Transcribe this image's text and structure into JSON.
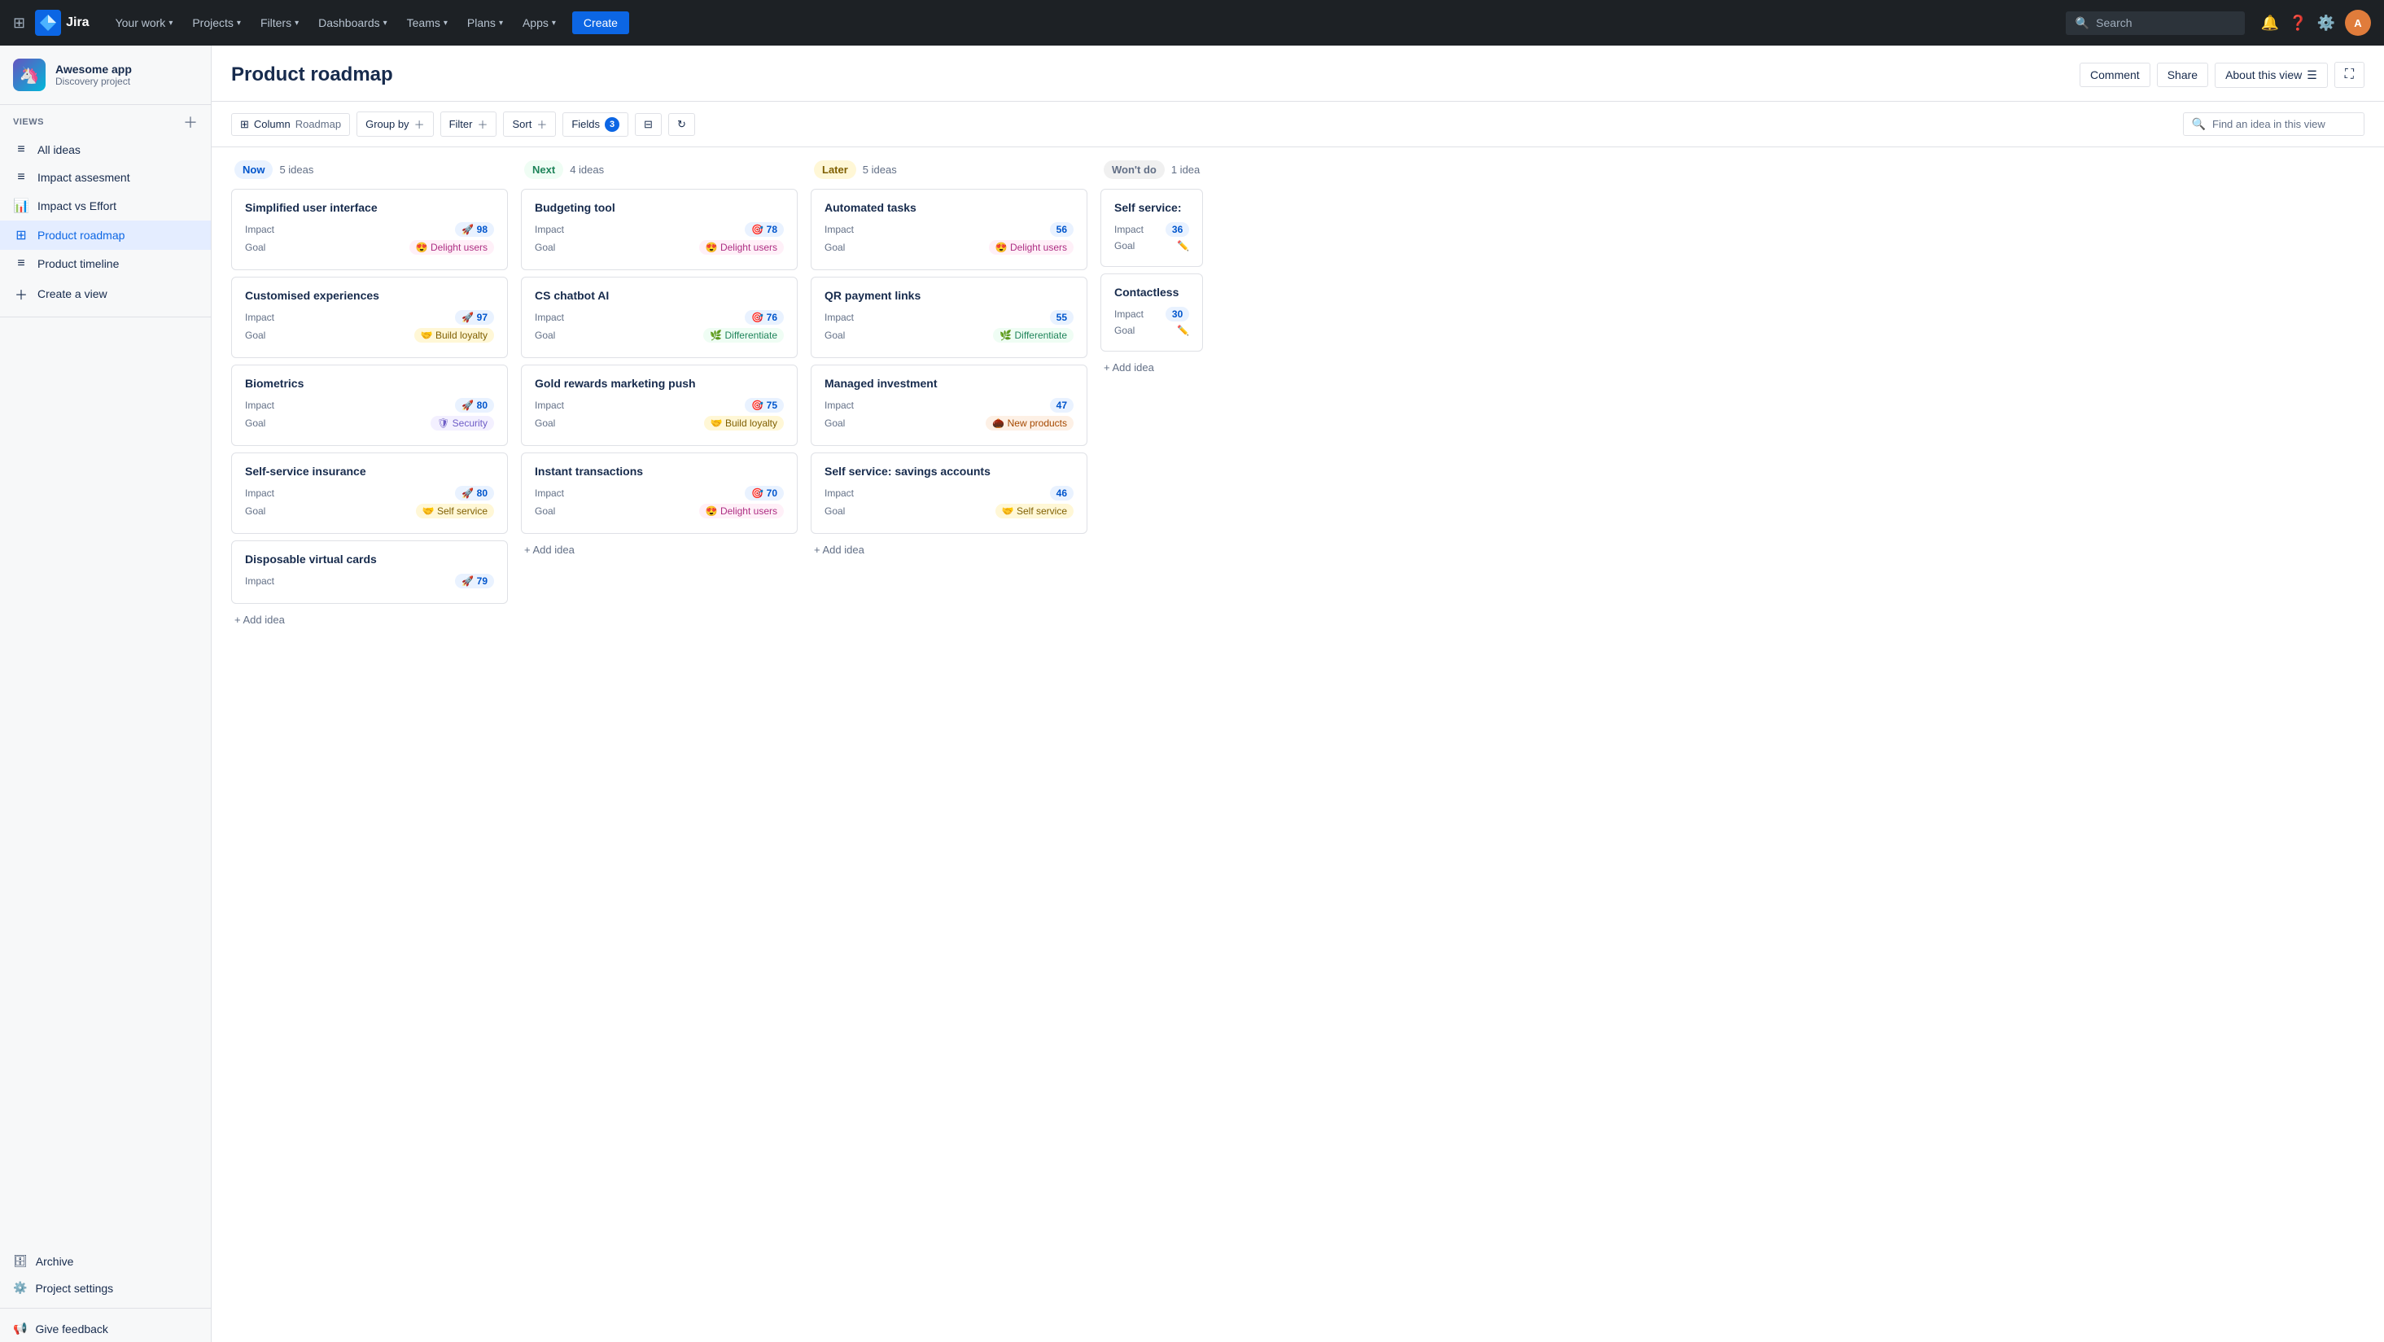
{
  "topnav": {
    "logo_text": "Jira",
    "items": [
      {
        "label": "Your work",
        "key": "your-work"
      },
      {
        "label": "Projects",
        "key": "projects"
      },
      {
        "label": "Filters",
        "key": "filters"
      },
      {
        "label": "Dashboards",
        "key": "dashboards"
      },
      {
        "label": "Teams",
        "key": "teams"
      },
      {
        "label": "Plans",
        "key": "plans"
      },
      {
        "label": "Apps",
        "key": "apps"
      }
    ],
    "create_label": "Create",
    "search_placeholder": "Search"
  },
  "sidebar": {
    "project_name": "Awesome app",
    "project_type": "Discovery project",
    "views_label": "VIEWS",
    "items": [
      {
        "label": "All ideas",
        "icon": "≡",
        "active": false
      },
      {
        "label": "Impact assesment",
        "icon": "≡",
        "active": false
      },
      {
        "label": "Impact vs Effort",
        "icon": "📊",
        "active": false
      },
      {
        "label": "Product roadmap",
        "icon": "⊞",
        "active": true
      },
      {
        "label": "Product timeline",
        "icon": "≡",
        "active": false
      }
    ],
    "create_view_label": "Create a view",
    "archive_label": "Archive",
    "settings_label": "Project settings",
    "feedback_label": "Give feedback"
  },
  "page": {
    "title": "Product roadmap",
    "comment_label": "Comment",
    "share_label": "Share",
    "about_label": "About this view"
  },
  "toolbar": {
    "column_label": "Column",
    "column_icon": "Roadmap",
    "groupby_label": "Group by",
    "filter_label": "Filter",
    "sort_label": "Sort",
    "fields_label": "Fields",
    "fields_count": "3",
    "search_placeholder": "Find an idea in this view"
  },
  "columns": [
    {
      "id": "now",
      "badge": "Now",
      "badge_class": "badge-now",
      "count": "5 ideas",
      "cards": [
        {
          "title": "Simplified user interface",
          "impact": "98",
          "impact_icon": "🚀",
          "goal": "Delight users",
          "goal_icon": "😍",
          "goal_class": "goal-delight"
        },
        {
          "title": "Customised experiences",
          "impact": "97",
          "impact_icon": "🚀",
          "goal": "Build loyalty",
          "goal_icon": "🤝",
          "goal_class": "goal-loyalty"
        },
        {
          "title": "Biometrics",
          "impact": "80",
          "impact_icon": "🚀",
          "goal": "Security",
          "goal_icon": "🛡",
          "goal_class": "goal-security"
        },
        {
          "title": "Self-service insurance",
          "impact": "80",
          "impact_icon": "🚀",
          "goal": "Self service",
          "goal_icon": "🤝",
          "goal_class": "goal-self"
        },
        {
          "title": "Disposable virtual cards",
          "impact": "79",
          "impact_icon": "🚀",
          "goal": "",
          "goal_icon": "",
          "goal_class": ""
        }
      ],
      "add_label": "+ Add idea"
    },
    {
      "id": "next",
      "badge": "Next",
      "badge_class": "badge-next",
      "count": "4 ideas",
      "cards": [
        {
          "title": "Budgeting tool",
          "impact": "78",
          "impact_icon": "🎯",
          "goal": "Delight users",
          "goal_icon": "😍",
          "goal_class": "goal-delight"
        },
        {
          "title": "CS chatbot AI",
          "impact": "76",
          "impact_icon": "🎯",
          "goal": "Differentiate",
          "goal_icon": "🌿",
          "goal_class": "goal-differentiate"
        },
        {
          "title": "Gold rewards marketing push",
          "impact": "75",
          "impact_icon": "🎯",
          "goal": "Build loyalty",
          "goal_icon": "🤝",
          "goal_class": "goal-loyalty"
        },
        {
          "title": "Instant transactions",
          "impact": "70",
          "impact_icon": "🎯",
          "goal": "Delight users",
          "goal_icon": "😍",
          "goal_class": "goal-delight"
        }
      ],
      "add_label": "+ Add idea"
    },
    {
      "id": "later",
      "badge": "Later",
      "badge_class": "badge-later",
      "count": "5 ideas",
      "cards": [
        {
          "title": "Automated tasks",
          "impact": "56",
          "impact_icon": "",
          "goal": "Delight users",
          "goal_icon": "😍",
          "goal_class": "goal-delight"
        },
        {
          "title": "QR payment links",
          "impact": "55",
          "impact_icon": "",
          "goal": "Differentiate",
          "goal_icon": "🌿",
          "goal_class": "goal-differentiate"
        },
        {
          "title": "Managed investment",
          "impact": "47",
          "impact_icon": "",
          "goal": "New products",
          "goal_icon": "🌰",
          "goal_class": "goal-new"
        },
        {
          "title": "Self service: savings accounts",
          "impact": "46",
          "impact_icon": "",
          "goal": "Self service",
          "goal_icon": "🤝",
          "goal_class": "goal-self"
        }
      ],
      "add_label": "+ Add idea"
    },
    {
      "id": "wontdo",
      "badge": "Won't do",
      "badge_class": "badge-wontdo",
      "count": "1 idea",
      "cards": [
        {
          "title": "Self service:",
          "impact": "36",
          "impact_icon": "",
          "goal": "",
          "goal_icon": "✏️",
          "goal_class": "goal-differentiate"
        },
        {
          "title": "Contactless",
          "impact": "30",
          "impact_icon": "",
          "goal": "",
          "goal_icon": "✏️",
          "goal_class": "goal-differentiate"
        }
      ],
      "add_label": "+ Add idea"
    }
  ]
}
